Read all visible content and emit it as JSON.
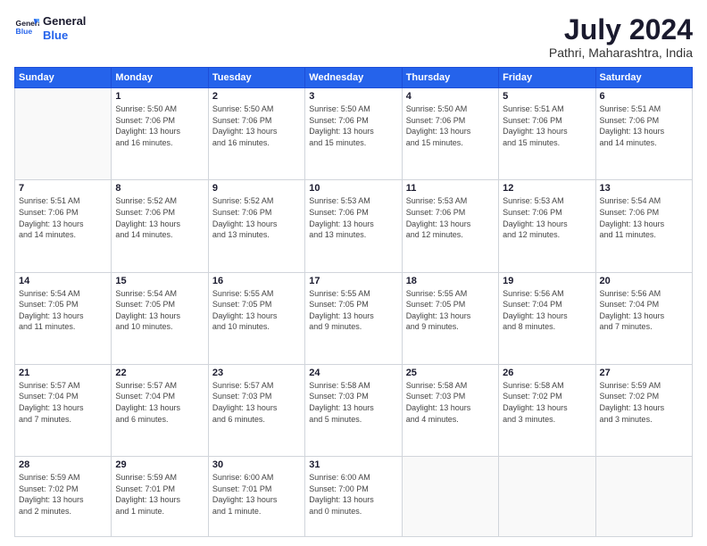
{
  "logo": {
    "line1": "General",
    "line2": "Blue"
  },
  "title": "July 2024",
  "location": "Pathri, Maharashtra, India",
  "days_header": [
    "Sunday",
    "Monday",
    "Tuesday",
    "Wednesday",
    "Thursday",
    "Friday",
    "Saturday"
  ],
  "weeks": [
    [
      {
        "day": "",
        "info": ""
      },
      {
        "day": "1",
        "info": "Sunrise: 5:50 AM\nSunset: 7:06 PM\nDaylight: 13 hours\nand 16 minutes."
      },
      {
        "day": "2",
        "info": "Sunrise: 5:50 AM\nSunset: 7:06 PM\nDaylight: 13 hours\nand 16 minutes."
      },
      {
        "day": "3",
        "info": "Sunrise: 5:50 AM\nSunset: 7:06 PM\nDaylight: 13 hours\nand 15 minutes."
      },
      {
        "day": "4",
        "info": "Sunrise: 5:50 AM\nSunset: 7:06 PM\nDaylight: 13 hours\nand 15 minutes."
      },
      {
        "day": "5",
        "info": "Sunrise: 5:51 AM\nSunset: 7:06 PM\nDaylight: 13 hours\nand 15 minutes."
      },
      {
        "day": "6",
        "info": "Sunrise: 5:51 AM\nSunset: 7:06 PM\nDaylight: 13 hours\nand 14 minutes."
      }
    ],
    [
      {
        "day": "7",
        "info": "Sunrise: 5:51 AM\nSunset: 7:06 PM\nDaylight: 13 hours\nand 14 minutes."
      },
      {
        "day": "8",
        "info": "Sunrise: 5:52 AM\nSunset: 7:06 PM\nDaylight: 13 hours\nand 14 minutes."
      },
      {
        "day": "9",
        "info": "Sunrise: 5:52 AM\nSunset: 7:06 PM\nDaylight: 13 hours\nand 13 minutes."
      },
      {
        "day": "10",
        "info": "Sunrise: 5:53 AM\nSunset: 7:06 PM\nDaylight: 13 hours\nand 13 minutes."
      },
      {
        "day": "11",
        "info": "Sunrise: 5:53 AM\nSunset: 7:06 PM\nDaylight: 13 hours\nand 12 minutes."
      },
      {
        "day": "12",
        "info": "Sunrise: 5:53 AM\nSunset: 7:06 PM\nDaylight: 13 hours\nand 12 minutes."
      },
      {
        "day": "13",
        "info": "Sunrise: 5:54 AM\nSunset: 7:06 PM\nDaylight: 13 hours\nand 11 minutes."
      }
    ],
    [
      {
        "day": "14",
        "info": "Sunrise: 5:54 AM\nSunset: 7:05 PM\nDaylight: 13 hours\nand 11 minutes."
      },
      {
        "day": "15",
        "info": "Sunrise: 5:54 AM\nSunset: 7:05 PM\nDaylight: 13 hours\nand 10 minutes."
      },
      {
        "day": "16",
        "info": "Sunrise: 5:55 AM\nSunset: 7:05 PM\nDaylight: 13 hours\nand 10 minutes."
      },
      {
        "day": "17",
        "info": "Sunrise: 5:55 AM\nSunset: 7:05 PM\nDaylight: 13 hours\nand 9 minutes."
      },
      {
        "day": "18",
        "info": "Sunrise: 5:55 AM\nSunset: 7:05 PM\nDaylight: 13 hours\nand 9 minutes."
      },
      {
        "day": "19",
        "info": "Sunrise: 5:56 AM\nSunset: 7:04 PM\nDaylight: 13 hours\nand 8 minutes."
      },
      {
        "day": "20",
        "info": "Sunrise: 5:56 AM\nSunset: 7:04 PM\nDaylight: 13 hours\nand 7 minutes."
      }
    ],
    [
      {
        "day": "21",
        "info": "Sunrise: 5:57 AM\nSunset: 7:04 PM\nDaylight: 13 hours\nand 7 minutes."
      },
      {
        "day": "22",
        "info": "Sunrise: 5:57 AM\nSunset: 7:04 PM\nDaylight: 13 hours\nand 6 minutes."
      },
      {
        "day": "23",
        "info": "Sunrise: 5:57 AM\nSunset: 7:03 PM\nDaylight: 13 hours\nand 6 minutes."
      },
      {
        "day": "24",
        "info": "Sunrise: 5:58 AM\nSunset: 7:03 PM\nDaylight: 13 hours\nand 5 minutes."
      },
      {
        "day": "25",
        "info": "Sunrise: 5:58 AM\nSunset: 7:03 PM\nDaylight: 13 hours\nand 4 minutes."
      },
      {
        "day": "26",
        "info": "Sunrise: 5:58 AM\nSunset: 7:02 PM\nDaylight: 13 hours\nand 3 minutes."
      },
      {
        "day": "27",
        "info": "Sunrise: 5:59 AM\nSunset: 7:02 PM\nDaylight: 13 hours\nand 3 minutes."
      }
    ],
    [
      {
        "day": "28",
        "info": "Sunrise: 5:59 AM\nSunset: 7:02 PM\nDaylight: 13 hours\nand 2 minutes."
      },
      {
        "day": "29",
        "info": "Sunrise: 5:59 AM\nSunset: 7:01 PM\nDaylight: 13 hours\nand 1 minute."
      },
      {
        "day": "30",
        "info": "Sunrise: 6:00 AM\nSunset: 7:01 PM\nDaylight: 13 hours\nand 1 minute."
      },
      {
        "day": "31",
        "info": "Sunrise: 6:00 AM\nSunset: 7:00 PM\nDaylight: 13 hours\nand 0 minutes."
      },
      {
        "day": "",
        "info": ""
      },
      {
        "day": "",
        "info": ""
      },
      {
        "day": "",
        "info": ""
      }
    ]
  ]
}
